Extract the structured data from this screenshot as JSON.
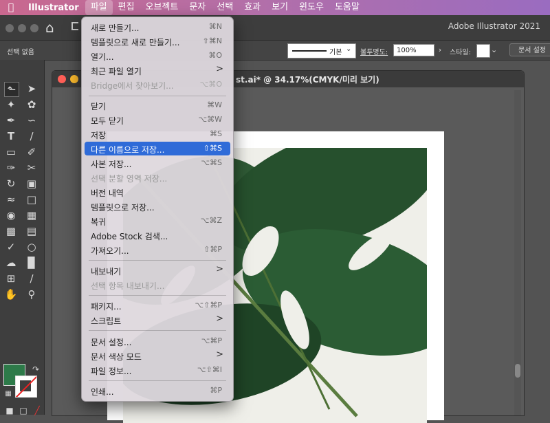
{
  "menubar": {
    "app_name": "Illustrator",
    "items": [
      "파일",
      "편집",
      "오브젝트",
      "문자",
      "선택",
      "효과",
      "보기",
      "윈도우",
      "도움말"
    ]
  },
  "appbar": {
    "title": "Adobe Illustrator 2021"
  },
  "control_bar": {
    "selection": "선택 없음",
    "stroke_label": "기본",
    "opacity_label": "불투명도:",
    "opacity_value": "100%",
    "style_label": "스타일:",
    "doc_setup": "문서 설정"
  },
  "document": {
    "title": "st.ai* @ 34.17%(CMYK/미리 보기)"
  },
  "file_menu": {
    "items": [
      {
        "label": "새로 만들기...",
        "shortcut": "⌘N"
      },
      {
        "label": "템플릿으로 새로 만들기...",
        "shortcut": "⇧⌘N"
      },
      {
        "label": "열기...",
        "shortcut": "⌘O"
      },
      {
        "label": "최근 파일 열기",
        "shortcut": ">"
      },
      {
        "label": "Bridge에서 찾아보기...",
        "shortcut": "⌥⌘O"
      },
      {
        "label": "닫기",
        "shortcut": "⌘W"
      },
      {
        "label": "모두 닫기",
        "shortcut": "⌥⌘W"
      },
      {
        "label": "저장",
        "shortcut": "⌘S"
      },
      {
        "label": "다른 이름으로 저장...",
        "shortcut": "⇧⌘S"
      },
      {
        "label": "사본 저장...",
        "shortcut": "⌥⌘S"
      },
      {
        "label": "선택 분할 영역 저장...",
        "shortcut": ""
      },
      {
        "label": "버전 내역",
        "shortcut": ""
      },
      {
        "label": "템플릿으로 저장...",
        "shortcut": ""
      },
      {
        "label": "복귀",
        "shortcut": "⌥⌘Z"
      },
      {
        "label": "Adobe Stock 검색...",
        "shortcut": ""
      },
      {
        "label": "가져오기...",
        "shortcut": "⇧⌘P"
      },
      {
        "label": "내보내기",
        "shortcut": ">"
      },
      {
        "label": "선택 항목 내보내기...",
        "shortcut": ""
      },
      {
        "label": "패키지...",
        "shortcut": "⌥⇧⌘P"
      },
      {
        "label": "스크립트",
        "shortcut": ">"
      },
      {
        "label": "문서 설정...",
        "shortcut": "⌥⌘P"
      },
      {
        "label": "문서 색상 모드",
        "shortcut": ">"
      },
      {
        "label": "파일 정보...",
        "shortcut": "⌥⇧⌘I"
      },
      {
        "label": "인쇄...",
        "shortcut": "⌘P"
      }
    ]
  },
  "colors": {
    "fill": "#2d7a49",
    "highlight": "#2f6bd8"
  }
}
